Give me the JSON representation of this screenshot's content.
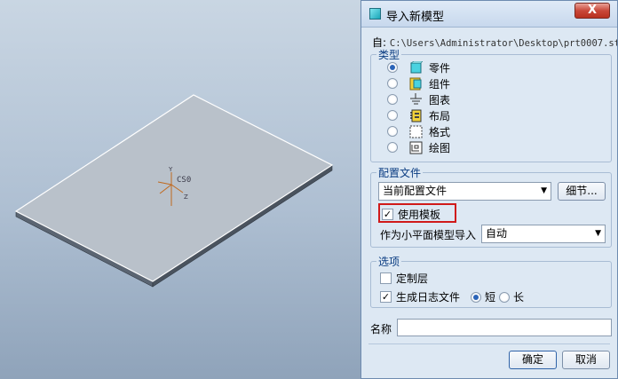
{
  "viewport": {
    "csys_label": "CS0",
    "axis_labels": {
      "y": "Y",
      "z": "Z"
    }
  },
  "dialog": {
    "title": "导入新模型",
    "close_glyph": "X",
    "from_label": "自:",
    "from_path": "C:\\Users\\Administrator\\Desktop\\prt0007.stp",
    "type_group": {
      "title": "类型",
      "options": [
        {
          "label": "零件",
          "icon": "part-icon",
          "checked": true
        },
        {
          "label": "组件",
          "icon": "assembly-icon",
          "checked": false
        },
        {
          "label": "图表",
          "icon": "diagram-icon",
          "checked": false
        },
        {
          "label": "布局",
          "icon": "layout-icon",
          "checked": false
        },
        {
          "label": "格式",
          "icon": "format-icon",
          "checked": false
        },
        {
          "label": "绘图",
          "icon": "drawing-icon",
          "checked": false
        }
      ]
    },
    "profile_group": {
      "title": "配置文件",
      "profile_value": "当前配置文件",
      "details_button": "细节...",
      "use_template_label": "使用模板",
      "use_template_checked": true,
      "import_as_label": "作为小平面模型导入",
      "import_as_value": "自动"
    },
    "options_group": {
      "title": "选项",
      "custom_layer_label": "定制层",
      "custom_layer_checked": false,
      "log_file_label": "生成日志文件",
      "log_file_checked": true,
      "short_label": "短",
      "long_label": "长",
      "short_checked": true
    },
    "name_label": "名称",
    "name_value": "",
    "ok_button": "确定",
    "cancel_button": "取消",
    "colors": {
      "highlight_border": "#d01a1a",
      "group_title": "#0a3c82",
      "radio_selected": "#2a64b8"
    }
  }
}
